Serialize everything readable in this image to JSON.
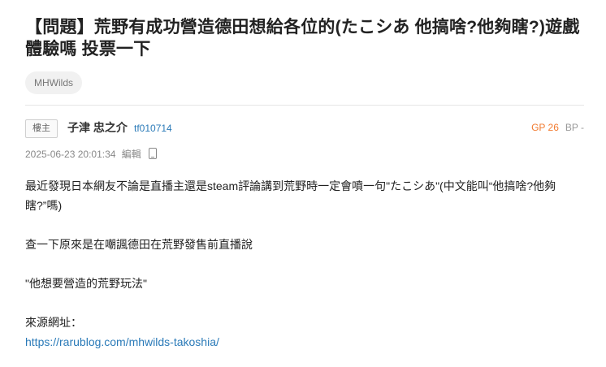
{
  "post": {
    "title": "【問題】荒野有成功營造德田想給各位的(たこシあ 他搞啥?他夠瞎?)遊戲體驗嗎 投票一下",
    "tag": "MHWilds",
    "floor_label": "樓主",
    "author_name": "子津 忠之介",
    "author_id": "tf010714",
    "gp": "GP 26",
    "bp": "BP -",
    "timestamp": "2025-06-23 20:01:34",
    "edit_label": "編輯",
    "body": {
      "para1": "最近發現日本網友不論是直播主還是steam評論講到荒野時一定會噴一句\"たこシあ\"(中文能叫“他搞啥?他夠瞎?”嗎)",
      "para2": "查一下原來是在嘲諷德田在荒野發售前直播說",
      "para3": "\"他想要營造的荒野玩法\"",
      "source_label": "來源網址：",
      "source_url": "https://rarublog.com/mhwilds-takoshia/"
    }
  },
  "colors": {
    "gp": "#f27b30",
    "link": "#2a7ab8",
    "muted": "#888888"
  },
  "icons": {
    "device": "mobile-phone-icon"
  }
}
